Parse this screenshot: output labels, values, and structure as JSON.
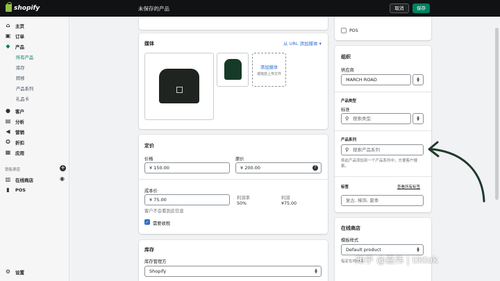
{
  "topbar": {
    "logo_text": "shopify",
    "unsaved_title": "未保存的产品",
    "cancel_label": "取消",
    "save_label": "保存"
  },
  "sidebar": {
    "items": [
      {
        "label": "主页",
        "icon": "home-icon"
      },
      {
        "label": "订单",
        "icon": "orders-icon"
      },
      {
        "label": "产品",
        "icon": "tag-icon"
      }
    ],
    "product_subitems": [
      "所有产品",
      "库存",
      "转移",
      "产品系列",
      "礼品卡"
    ],
    "items2": [
      {
        "label": "客户",
        "icon": "customers-icon"
      },
      {
        "label": "分析",
        "icon": "analytics-icon"
      },
      {
        "label": "营销",
        "icon": "marketing-icon"
      },
      {
        "label": "折扣",
        "icon": "discount-icon"
      },
      {
        "label": "应用",
        "icon": "apps-icon"
      }
    ],
    "channels_heading": "销售渠道",
    "channels": [
      {
        "label": "在线商店",
        "icon": "store-icon"
      },
      {
        "label": "POS",
        "icon": "pos-icon"
      }
    ],
    "settings_label": "设置"
  },
  "media": {
    "title": "媒体",
    "url_link": "从 URL 添加媒体 ▾",
    "add_media": "添加媒体",
    "add_hint": "或拖放上传文件"
  },
  "pricing": {
    "title": "定价",
    "price_label": "价格",
    "price_value": "¥  150.00",
    "compare_label": "原价",
    "compare_value": "¥  200.00",
    "cost_label": "成本价",
    "cost_value": "¥  75.00",
    "margin_label": "利润率",
    "margin_value": "50%",
    "profit_label": "利润",
    "profit_value": "¥75.00",
    "cost_hint": "客户不会看到此信息",
    "tax_label": "需要收税"
  },
  "inventory": {
    "title": "库存",
    "manager_label": "库存管理方",
    "manager_value": "Shopify"
  },
  "right": {
    "pos_label": "POS",
    "org_title": "组织",
    "vendor_label": "供应商",
    "vendor_value": "MARCH ROAD",
    "type_heading": "产品类型",
    "type_label": "标准",
    "type_placeholder": "搜索类型",
    "collection_heading": "产品系列",
    "collection_placeholder": "搜索产品系列",
    "collection_hint": "将此产品添加到一个产品系列中，方便客户搜索。",
    "tags_heading": "标签",
    "tags_link": "查看所有标签",
    "tags_placeholder": "复古, 稀饰, 夏季",
    "store_title": "在线商店",
    "template_label": "模板样式",
    "template_value": "Default product",
    "template_hint": "指定在线商店..."
  },
  "watermark": "知乎 @嘉伟 | tiktok",
  "colors": {
    "brand_green": "#008060",
    "link_blue": "#2c6ecb",
    "annotation_arrow": "#1f3a2c"
  }
}
